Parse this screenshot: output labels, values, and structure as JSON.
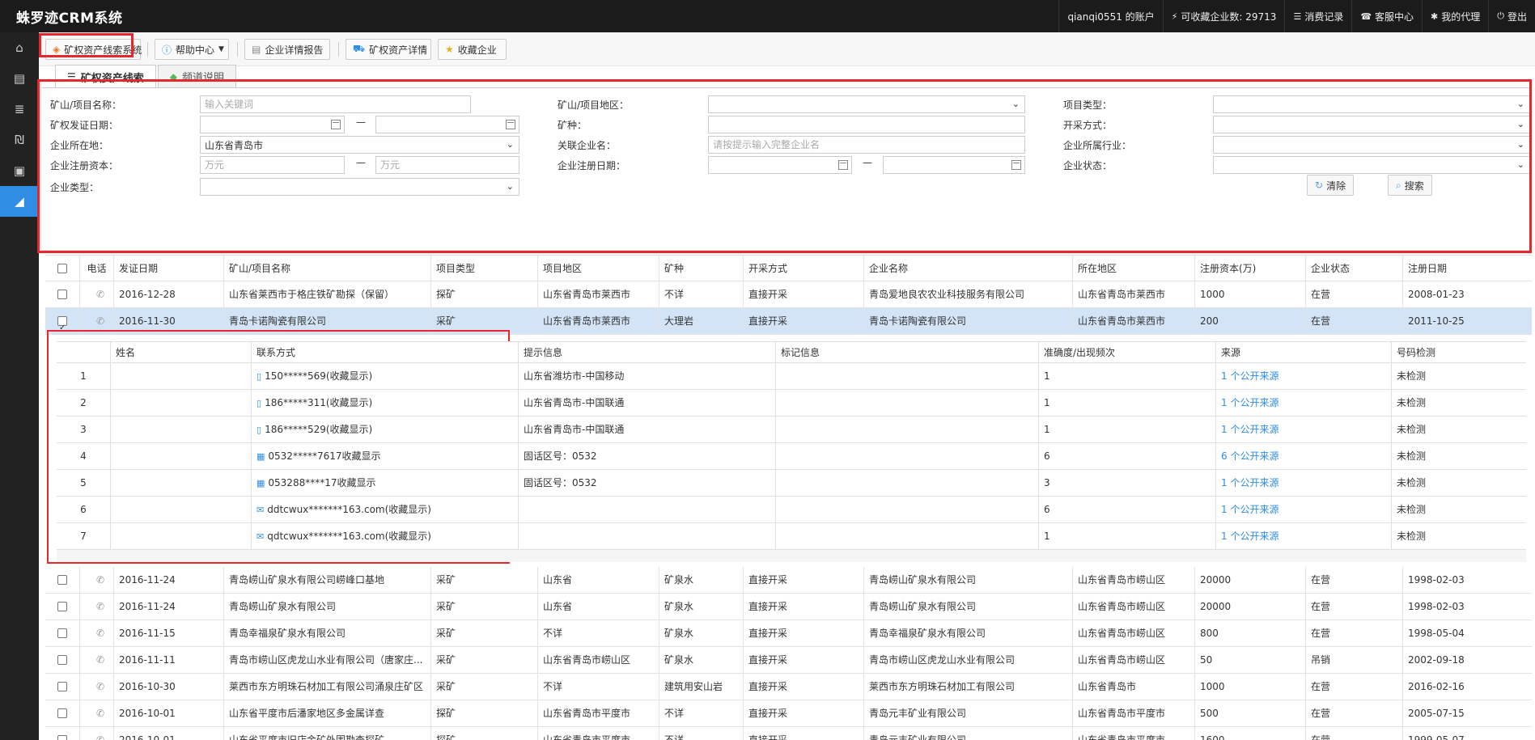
{
  "app": {
    "title": "蛛罗迹CRM系统"
  },
  "topnav": [
    {
      "label": "qianqi0551 的账户",
      "icon": ""
    },
    {
      "label": "可收藏企业数: 29713",
      "icon": "⚡"
    },
    {
      "label": "消费记录",
      "icon": "☰"
    },
    {
      "label": "客服中心",
      "icon": "☎"
    },
    {
      "label": "我的代理",
      "icon": "✱"
    },
    {
      "label": "登出",
      "icon": "⏻"
    }
  ],
  "sidebar": [
    {
      "name": "home-icon",
      "glyph": "⌂"
    },
    {
      "name": "store-icon",
      "glyph": "▤"
    },
    {
      "name": "database-icon",
      "glyph": "≣"
    },
    {
      "name": "currency-icon",
      "glyph": "₪"
    },
    {
      "name": "archive-icon",
      "glyph": "▣"
    },
    {
      "name": "chart-icon",
      "glyph": "◢"
    }
  ],
  "toolbar": {
    "system_label": "矿权资产线索系统",
    "help_label": "帮助中心",
    "report_label": "企业详情报告",
    "asset_label": "矿权资产详情",
    "fav_label": "收藏企业"
  },
  "tabs": {
    "search": "矿权资产线索",
    "notes": "频道说明"
  },
  "form": {
    "mine_name": "矿山/项目名称：",
    "mine_name_ph": "输入关键词",
    "mine_region": "矿山/项目地区：",
    "project_type": "项目类型：",
    "license_date": "矿权发证日期：",
    "mineral": "矿种：",
    "mining_method": "开采方式：",
    "company_location": "企业所在地：",
    "company_location_value": "山东省青岛市",
    "related_company": "关联企业名：",
    "related_company_ph": "请按提示输入完整企业名",
    "industry": "企业所属行业：",
    "reg_capital": "企业注册资本：",
    "capital_ph": "万元",
    "reg_date": "企业注册日期：",
    "company_status": "企业状态：",
    "company_type": "企业类型：",
    "dash": "—",
    "clear": "清除",
    "search": "搜索"
  },
  "table": {
    "headers": [
      "电话",
      "发证日期",
      "矿山/项目名称",
      "项目类型",
      "项目地区",
      "矿种",
      "开采方式",
      "企业名称",
      "所在地区",
      "注册资本(万)",
      "企业状态",
      "注册日期"
    ],
    "rows_top": [
      {
        "checked": false,
        "cells": [
          "2016-12-28",
          "山东省莱西市于格庄铁矿勘探（保留）",
          "探矿",
          "山东省青岛市莱西市",
          "不详",
          "直接开采",
          "青岛爱地良农农业科技服务有限公司",
          "山东省青岛市莱西市",
          "1000",
          "在营",
          "2008-01-23"
        ]
      },
      {
        "checked": true,
        "cells": [
          "2016-11-30",
          "青岛卡诺陶瓷有限公司",
          "采矿",
          "山东省青岛市莱西市",
          "大理岩",
          "直接开采",
          "青岛卡诺陶瓷有限公司",
          "山东省青岛市莱西市",
          "200",
          "在营",
          "2011-10-25"
        ]
      }
    ],
    "rows_bottom": [
      {
        "checked": false,
        "cells": [
          "2016-11-24",
          "青岛崂山矿泉水有限公司崂峰口基地",
          "采矿",
          "山东省",
          "矿泉水",
          "直接开采",
          "青岛崂山矿泉水有限公司",
          "山东省青岛市崂山区",
          "20000",
          "在营",
          "1998-02-03"
        ]
      },
      {
        "checked": false,
        "cells": [
          "2016-11-24",
          "青岛崂山矿泉水有限公司",
          "采矿",
          "山东省",
          "矿泉水",
          "直接开采",
          "青岛崂山矿泉水有限公司",
          "山东省青岛市崂山区",
          "20000",
          "在营",
          "1998-02-03"
        ]
      },
      {
        "checked": false,
        "cells": [
          "2016-11-15",
          "青岛幸福泉矿泉水有限公司",
          "采矿",
          "不详",
          "矿泉水",
          "直接开采",
          "青岛幸福泉矿泉水有限公司",
          "山东省青岛市崂山区",
          "800",
          "在营",
          "1998-05-04"
        ]
      },
      {
        "checked": false,
        "cells": [
          "2016-11-11",
          "青岛市崂山区虎龙山水业有限公司（唐家庄...",
          "采矿",
          "山东省青岛市崂山区",
          "矿泉水",
          "直接开采",
          "青岛市崂山区虎龙山水业有限公司",
          "山东省青岛市崂山区",
          "50",
          "吊销",
          "2002-09-18"
        ]
      },
      {
        "checked": false,
        "cells": [
          "2016-10-30",
          "莱西市东方明珠石材加工有限公司涌泉庄矿区",
          "采矿",
          "不详",
          "建筑用安山岩",
          "直接开采",
          "莱西市东方明珠石材加工有限公司",
          "山东省青岛市",
          "1000",
          "在营",
          "2016-02-16"
        ]
      },
      {
        "checked": false,
        "cells": [
          "2016-10-01",
          "山东省平度市后潘家地区多金属详查",
          "探矿",
          "山东省青岛市平度市",
          "不详",
          "直接开采",
          "青岛元丰矿业有限公司",
          "山东省青岛市平度市",
          "500",
          "在营",
          "2005-07-15"
        ]
      },
      {
        "checked": false,
        "cells": [
          "2016-10-01",
          "山东省平度市旧店金矿外围勘查探矿",
          "探矿",
          "山东省青岛市平度市",
          "不详",
          "直接开采",
          "青岛元丰矿业有限公司",
          "山东省青岛市平度市",
          "1600",
          "在营",
          "1999-05-07"
        ]
      }
    ]
  },
  "detail": {
    "headers": [
      "姓名",
      "联系方式",
      "提示信息",
      "标记信息",
      "准确度/出现频次",
      "来源",
      "号码检测"
    ],
    "rows": [
      {
        "idx": "1",
        "kind": "mobile",
        "contact": "150*****569(收藏显示)",
        "hint": "山东省潍坊市-中国移动",
        "freq": "1",
        "source": "1  个公开来源",
        "check": "未检测"
      },
      {
        "idx": "2",
        "kind": "mobile",
        "contact": "186*****311(收藏显示)",
        "hint": "山东省青岛市-中国联通",
        "freq": "1",
        "source": "1  个公开来源",
        "check": "未检测"
      },
      {
        "idx": "3",
        "kind": "mobile",
        "contact": "186*****529(收藏显示)",
        "hint": "山东省青岛市-中国联通",
        "freq": "1",
        "source": "1  个公开来源",
        "check": "未检测"
      },
      {
        "idx": "4",
        "kind": "landline",
        "contact": "0532*****7617收藏显示",
        "hint": "固话区号：0532",
        "freq": "6",
        "source": "6  个公开来源",
        "check": "未检测"
      },
      {
        "idx": "5",
        "kind": "landline",
        "contact": "053288****17收藏显示",
        "hint": "固话区号：0532",
        "freq": "3",
        "source": "1  个公开来源",
        "check": "未检测"
      },
      {
        "idx": "6",
        "kind": "email",
        "contact": "ddtcwux*******163.com(收藏显示)",
        "hint": "",
        "freq": "6",
        "source": "1  个公开来源",
        "check": "未检测"
      },
      {
        "idx": "7",
        "kind": "email",
        "contact": "qdtcwux*******163.com(收藏显示)",
        "hint": "",
        "freq": "1",
        "source": "1  个公开来源",
        "check": "未检测"
      }
    ]
  }
}
